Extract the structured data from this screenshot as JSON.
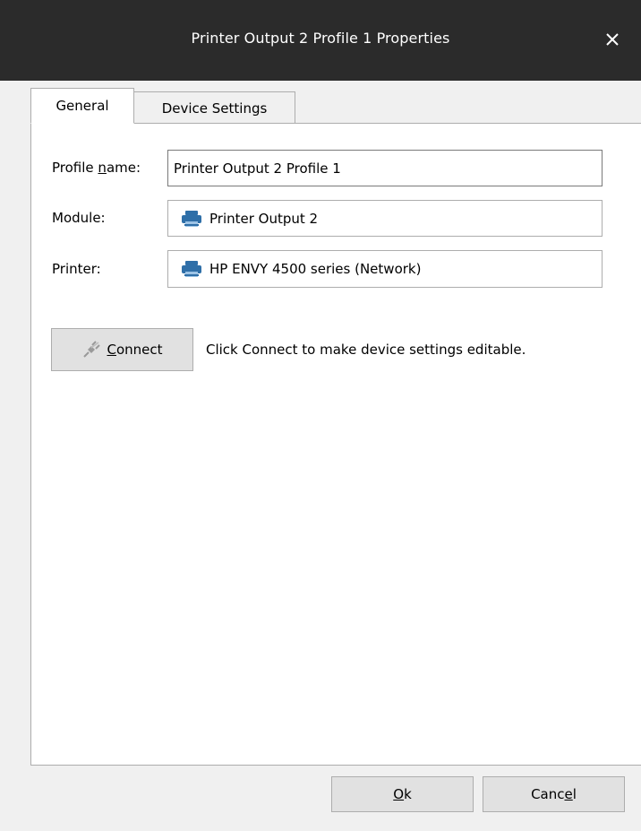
{
  "window": {
    "title": "Printer Output 2 Profile 1 Properties",
    "close_glyph": "✕"
  },
  "tabs": [
    {
      "label": "General",
      "active": true
    },
    {
      "label": "Device Settings",
      "active": false
    }
  ],
  "general": {
    "profile_name_label_pre": "Profile ",
    "profile_name_label_accel": "n",
    "profile_name_label_post": "ame:",
    "profile_name_value": "Printer Output 2 Profile 1",
    "module_label": "Module:",
    "module_value": "Printer Output 2",
    "printer_label": "Printer:",
    "printer_value": "HP ENVY 4500 series (Network)",
    "connect_accel": "C",
    "connect_rest": "onnect",
    "connect_hint": "Click Connect to make device settings editable."
  },
  "footer": {
    "ok_accel": "O",
    "ok_rest": "k",
    "cancel_pre": "Canc",
    "cancel_accel": "e",
    "cancel_post": "l"
  },
  "icons": {
    "module_icon": "printer-icon",
    "printer_icon": "printer-icon",
    "connect_icon": "plug-icon"
  },
  "colors": {
    "titlebar": "#2b2b2b",
    "dialog_bg": "#f0f0f0",
    "printer_icon": "#2f6fa8"
  }
}
